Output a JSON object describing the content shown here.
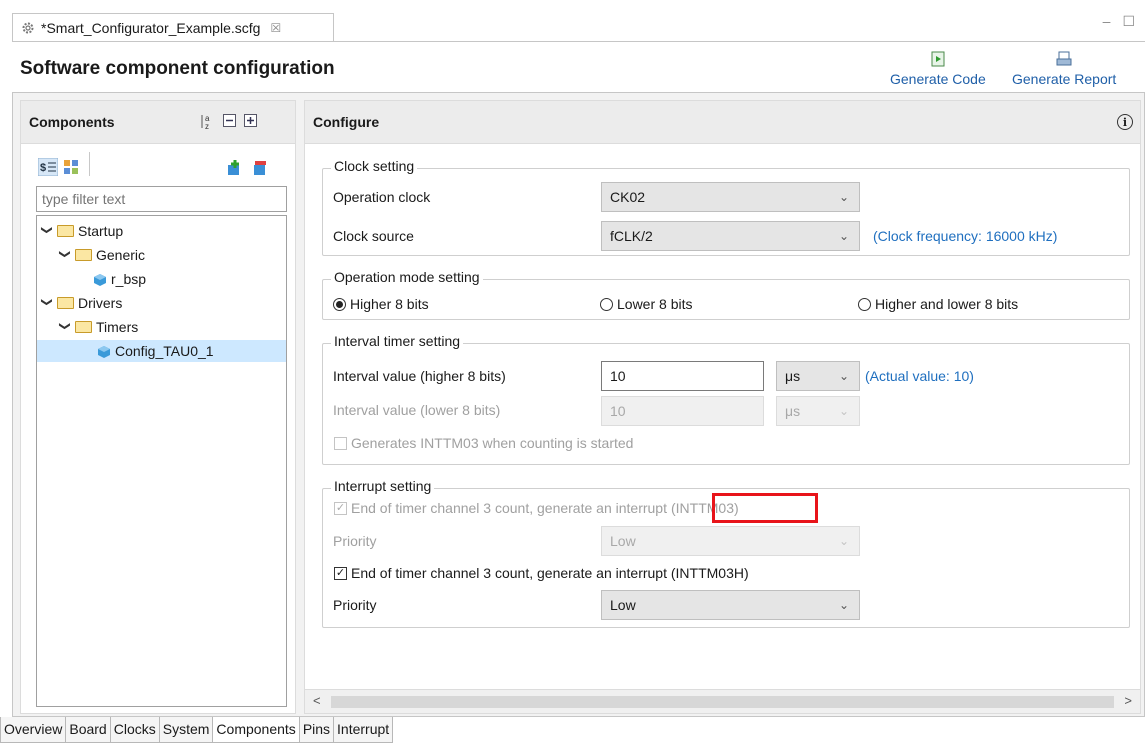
{
  "editor_tab": {
    "title": "*Smart_Configurator_Example.scfg",
    "close_glyph": "☒"
  },
  "window_controls": {
    "minimize": "–",
    "maximize": "☐"
  },
  "page_title": "Software component configuration",
  "toolbar": {
    "generate_code": "Generate Code",
    "generate_report": "Generate Report"
  },
  "components_panel": {
    "title": "Components",
    "filter_placeholder": "type filter text",
    "tree": [
      {
        "label": "Startup",
        "type": "folder",
        "level": 0,
        "expanded": true
      },
      {
        "label": "Generic",
        "type": "folder",
        "level": 1,
        "expanded": true
      },
      {
        "label": "r_bsp",
        "type": "component",
        "level": 2
      },
      {
        "label": "Drivers",
        "type": "folder",
        "level": 0,
        "expanded": true
      },
      {
        "label": "Timers",
        "type": "folder",
        "level": 1,
        "expanded": true
      },
      {
        "label": "Config_TAU0_1",
        "type": "component",
        "level": 2,
        "selected": true
      }
    ]
  },
  "configure_panel": {
    "title": "Configure",
    "clock_setting": {
      "legend": "Clock setting",
      "operation_clock_label": "Operation clock",
      "operation_clock_value": "CK02",
      "clock_source_label": "Clock source",
      "clock_source_value": "fCLK/2",
      "clock_frequency_note": "(Clock frequency: 16000 kHz)"
    },
    "operation_mode": {
      "legend": "Operation mode setting",
      "options": [
        "Higher 8 bits",
        "Lower 8 bits",
        "Higher and lower 8 bits"
      ],
      "selected": "Higher 8 bits"
    },
    "interval_timer": {
      "legend": "Interval timer setting",
      "higher_label": "Interval value (higher 8 bits)",
      "higher_value": "10",
      "higher_unit": "μs",
      "actual_value_note": "(Actual value: 10)",
      "lower_label": "Interval value (lower 8 bits)",
      "lower_value": "10",
      "lower_unit": "μs",
      "generate_on_start_label": "Generates INTTM03 when counting is started",
      "generate_on_start_checked": false
    },
    "interrupt_setting": {
      "legend": "Interrupt setting",
      "inttm03_label_prefix": "End of timer channel 3 count, generate an interrupt",
      "inttm03_label_suffix": "(INTTM03)",
      "inttm03_checked": true,
      "priority1_label": "Priority",
      "priority1_value": "Low",
      "inttm03h_label": "End of timer channel 3 count, generate an interrupt (INTTM03H)",
      "inttm03h_checked": true,
      "priority2_label": "Priority",
      "priority2_value": "Low"
    }
  },
  "bottom_tabs": [
    "Overview",
    "Board",
    "Clocks",
    "System",
    "Components",
    "Pins",
    "Interrupt"
  ],
  "active_bottom_tab": "Components",
  "colors": {
    "link": "#1f6fbf",
    "highlight": "#e8141a",
    "selection": "#cde8ff"
  }
}
